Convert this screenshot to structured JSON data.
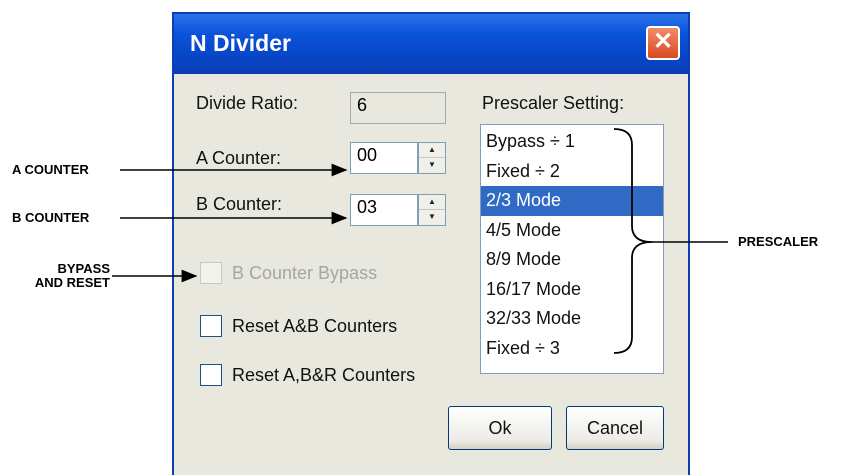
{
  "window": {
    "title": "N Divider",
    "close_glyph": "✕"
  },
  "divide_ratio": {
    "label": "Divide Ratio:",
    "value": "6"
  },
  "a_counter": {
    "label": "A Counter:",
    "value": "00"
  },
  "b_counter": {
    "label": "B Counter:",
    "value": "03"
  },
  "checkboxes": {
    "bypass": {
      "label": "B Counter Bypass",
      "checked": false,
      "enabled": false
    },
    "reset_ab": {
      "label": "Reset A&B Counters",
      "checked": false,
      "enabled": true
    },
    "reset_abr": {
      "label": "Reset A,B&R Counters",
      "checked": false,
      "enabled": true
    }
  },
  "prescaler": {
    "label": "Prescaler Setting:",
    "items": [
      "Bypass ÷ 1",
      "Fixed ÷ 2",
      "2/3 Mode",
      "4/5 Mode",
      "8/9 Mode",
      "16/17 Mode",
      "32/33 Mode",
      "Fixed ÷ 3"
    ],
    "selected": "2/3 Mode"
  },
  "buttons": {
    "ok": "Ok",
    "cancel": "Cancel"
  },
  "callouts": {
    "a_counter": "A COUNTER",
    "b_counter": "B COUNTER",
    "bypass_line1": "BYPASS",
    "bypass_line2": "AND RESET",
    "prescaler": "PRESCALER"
  },
  "colors": {
    "title_bar": "#0a52d8",
    "selection": "#316ac5",
    "close_button": "#d94a20"
  }
}
